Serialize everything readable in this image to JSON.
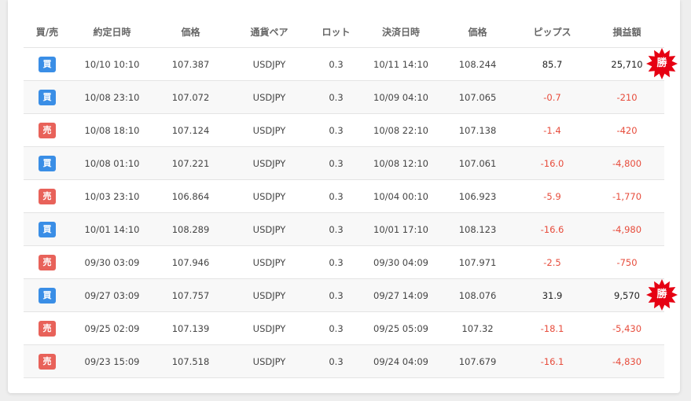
{
  "table": {
    "headers": [
      "買/売",
      "約定日時",
      "価格",
      "通貨ペア",
      "ロット",
      "決済日時",
      "価格",
      "ピップス",
      "損益額"
    ],
    "rows": [
      {
        "side": "買",
        "type": "buy",
        "open": "10/10 10:10",
        "open_price": "107.387",
        "pair": "USDJPY",
        "lot": "0.3",
        "close": "10/11 14:10",
        "close_price": "108.244",
        "pips": "85.7",
        "pnl": "25,710",
        "result": "positive"
      },
      {
        "side": "買",
        "type": "buy",
        "open": "10/08 23:10",
        "open_price": "107.072",
        "pair": "USDJPY",
        "lot": "0.3",
        "close": "10/09 04:10",
        "close_price": "107.065",
        "pips": "-0.7",
        "pnl": "-210",
        "result": "negative"
      },
      {
        "side": "売",
        "type": "sell",
        "open": "10/08 18:10",
        "open_price": "107.124",
        "pair": "USDJPY",
        "lot": "0.3",
        "close": "10/08 22:10",
        "close_price": "107.138",
        "pips": "-1.4",
        "pnl": "-420",
        "result": "negative"
      },
      {
        "side": "買",
        "type": "buy",
        "open": "10/08 01:10",
        "open_price": "107.221",
        "pair": "USDJPY",
        "lot": "0.3",
        "close": "10/08 12:10",
        "close_price": "107.061",
        "pips": "-16.0",
        "pnl": "-4,800",
        "result": "negative"
      },
      {
        "side": "売",
        "type": "sell",
        "open": "10/03 23:10",
        "open_price": "106.864",
        "pair": "USDJPY",
        "lot": "0.3",
        "close": "10/04 00:10",
        "close_price": "106.923",
        "pips": "-5.9",
        "pnl": "-1,770",
        "result": "negative"
      },
      {
        "side": "買",
        "type": "buy",
        "open": "10/01 14:10",
        "open_price": "108.289",
        "pair": "USDJPY",
        "lot": "0.3",
        "close": "10/01 17:10",
        "close_price": "108.123",
        "pips": "-16.6",
        "pnl": "-4,980",
        "result": "negative"
      },
      {
        "side": "売",
        "type": "sell",
        "open": "09/30 03:09",
        "open_price": "107.946",
        "pair": "USDJPY",
        "lot": "0.3",
        "close": "09/30 04:09",
        "close_price": "107.971",
        "pips": "-2.5",
        "pnl": "-750",
        "result": "negative"
      },
      {
        "side": "買",
        "type": "buy",
        "open": "09/27 03:09",
        "open_price": "107.757",
        "pair": "USDJPY",
        "lot": "0.3",
        "close": "09/27 14:09",
        "close_price": "108.076",
        "pips": "31.9",
        "pnl": "9,570",
        "result": "positive"
      },
      {
        "side": "売",
        "type": "sell",
        "open": "09/25 02:09",
        "open_price": "107.139",
        "pair": "USDJPY",
        "lot": "0.3",
        "close": "09/25 05:09",
        "close_price": "107.32",
        "pips": "-18.1",
        "pnl": "-5,430",
        "result": "negative"
      },
      {
        "side": "売",
        "type": "sell",
        "open": "09/23 15:09",
        "open_price": "107.518",
        "pair": "USDJPY",
        "lot": "0.3",
        "close": "09/24 04:09",
        "close_price": "107.679",
        "pips": "-16.1",
        "pnl": "-4,830",
        "result": "negative"
      }
    ]
  },
  "win_badge": {
    "label": "勝",
    "icon": "starburst-icon"
  },
  "colors": {
    "buy": "#3a8ee6",
    "sell": "#e8625a",
    "negative": "#e74c3c",
    "win_badge": "#e60012"
  }
}
